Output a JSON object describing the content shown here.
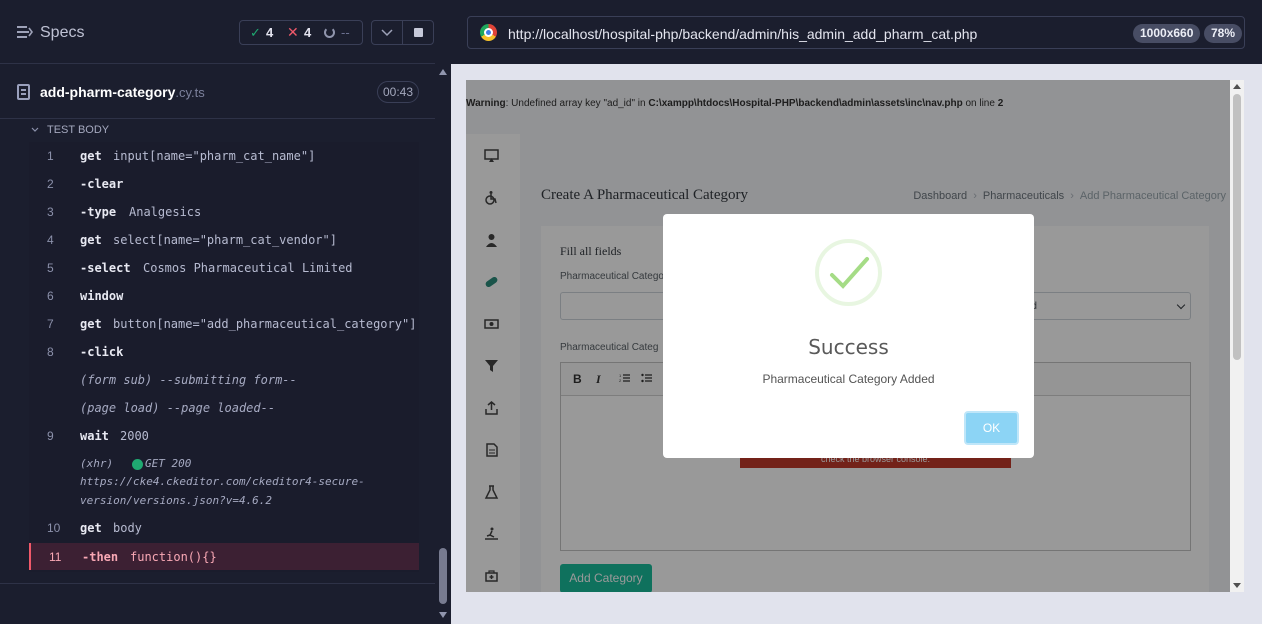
{
  "runner": {
    "specs_label": "Specs",
    "stats": {
      "passed": "4",
      "failed": "4",
      "pending": "--"
    },
    "spec": {
      "name": "add-pharm-category",
      "ext": ".cy.ts",
      "time": "00:43"
    },
    "test_body_label": "TEST BODY",
    "commands": [
      {
        "num": "1",
        "name": "get",
        "msg": "input[name=\"pharm_cat_name\"]"
      },
      {
        "num": "2",
        "name": "-clear",
        "msg": ""
      },
      {
        "num": "3",
        "name": "-type",
        "msg": "Analgesics"
      },
      {
        "num": "4",
        "name": "get",
        "msg": "select[name=\"pharm_cat_vendor\"]"
      },
      {
        "num": "5",
        "name": "-select",
        "msg": "Cosmos Pharmaceutical Limited"
      },
      {
        "num": "6",
        "name": "window",
        "msg": ""
      },
      {
        "num": "7",
        "name": "get",
        "msg": "button[name=\"add_pharmaceutical_category\"]"
      },
      {
        "num": "8",
        "name": "-click",
        "msg": ""
      },
      {
        "num": "",
        "name": "",
        "msg": "(form sub)  --submitting form--"
      },
      {
        "num": "",
        "name": "",
        "msg": "(page load)  --page loaded--"
      },
      {
        "num": "9",
        "name": "wait",
        "msg": "2000"
      },
      {
        "num": "10",
        "name": "get",
        "msg": "body"
      },
      {
        "num": "11",
        "name": "-then",
        "msg": "function(){}"
      }
    ],
    "xhr": {
      "label": "(xhr)",
      "method": "GET 200",
      "url_line1": "https://cke4.ckeditor.com/ckeditor4-secure-",
      "url_line2": "version/versions.json?v=4.6.2"
    }
  },
  "browser": {
    "url": "http://localhost/hospital-php/backend/admin/his_admin_add_pharm_cat.php",
    "viewport": "1000x660",
    "zoom": "78%"
  },
  "aut": {
    "warning_label": "Warning",
    "warning_text": ": Undefined array key \"ad_id\" in ",
    "warning_path": "C:\\xampp\\htdocs\\Hospital-PHP\\backend\\admin\\assets\\inc\\nav.php",
    "warning_online": " on line ",
    "warning_line": "2",
    "page_title": "Create A Pharmaceutical Category",
    "breadcrumbs": [
      "Dashboard",
      "Pharmaceuticals",
      "Add Pharmaceutical Category"
    ],
    "card_title": "Fill all fields",
    "label_name": "Pharmaceutical Category",
    "vendor_value": "ted",
    "label_desc": "Pharmaceutical Categ",
    "editor_notice": "check the browser console.",
    "add_button": "Add Category",
    "sidebar_icons": [
      "monitor-icon",
      "wheelchair-icon",
      "doctor-icon",
      "pill-icon",
      "cash-icon",
      "filter-icon",
      "upload-icon",
      "document-icon",
      "flask-icon",
      "treadmill-icon",
      "ambulance-icon"
    ]
  },
  "modal": {
    "title": "Success",
    "text": "Pharmaceutical Category Added",
    "ok": "OK"
  },
  "colors": {
    "runner_bg": "#1b1e2e",
    "pass": "#1fa971",
    "fail": "#f0596a",
    "success_green": "#a5dc86",
    "ok_button": "#8cd4f5",
    "add_button": "#1abc9c"
  }
}
